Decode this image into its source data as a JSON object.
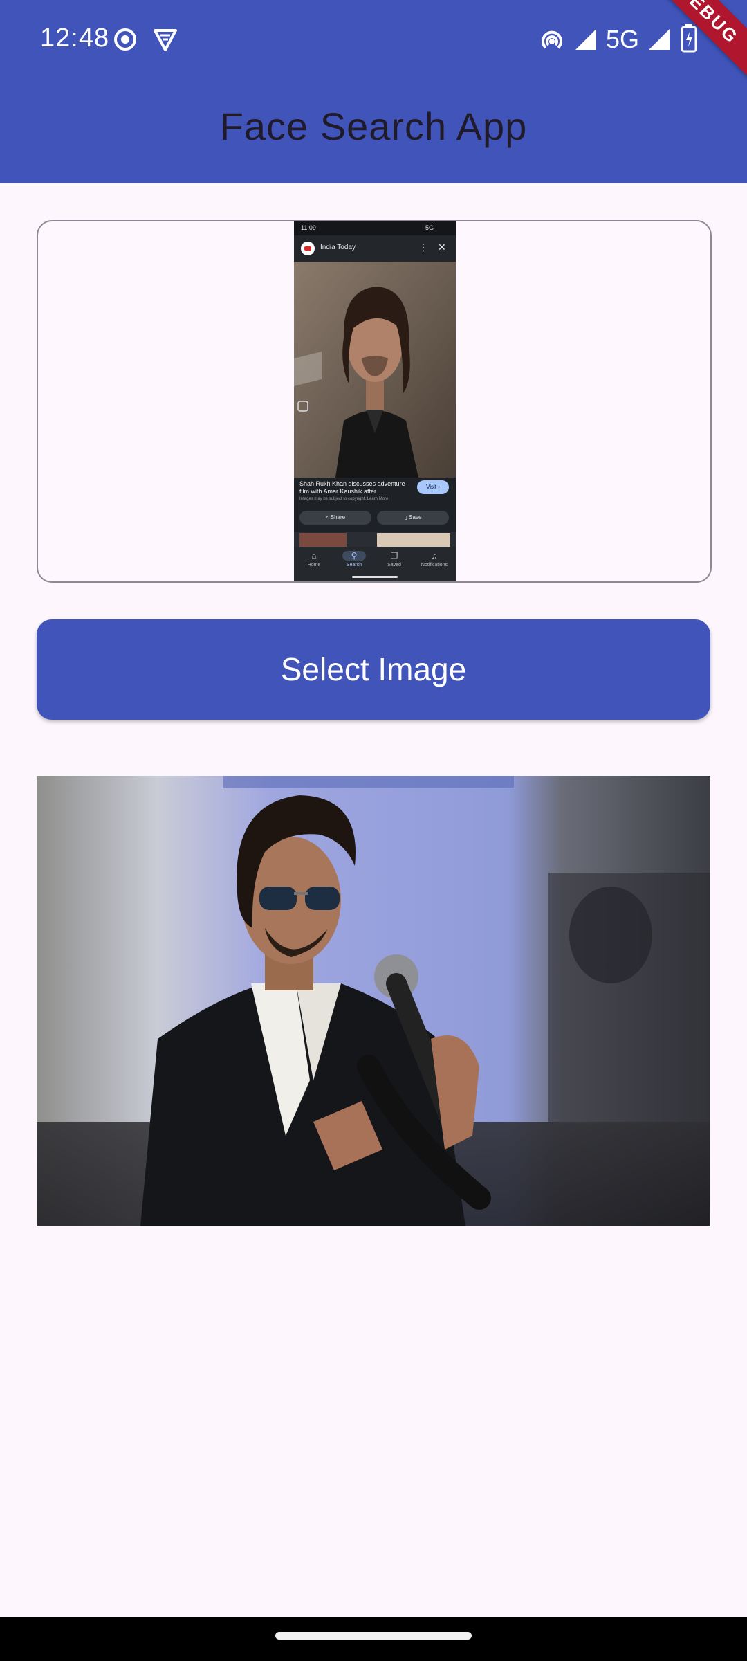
{
  "status_bar": {
    "time": "12:48",
    "network": "5G",
    "icons": [
      "screen-record-icon",
      "vpn-shield-icon",
      "hotspot-icon",
      "signal-icon",
      "signal-icon",
      "battery-icon"
    ]
  },
  "app_bar": {
    "title": "Face Search App",
    "debug_banner": "DEBUG"
  },
  "preview_screenshot": {
    "status_time": "11:09",
    "status_network": "5G",
    "source_name": "India Today",
    "caption": "Shah Rukh Khan discusses adventure film with Amar Kaushik after ...",
    "credit": "Images may be subject to copyright. Learn More",
    "visit_label": "Visit",
    "share_label": "Share",
    "save_label": "Save",
    "nav": [
      "Home",
      "Search",
      "Saved",
      "Notifications"
    ]
  },
  "select_button": {
    "label": "Select Image"
  },
  "colors": {
    "primary": "#4154BA",
    "background": "#FDF7FD",
    "debug": "#B0172E"
  }
}
